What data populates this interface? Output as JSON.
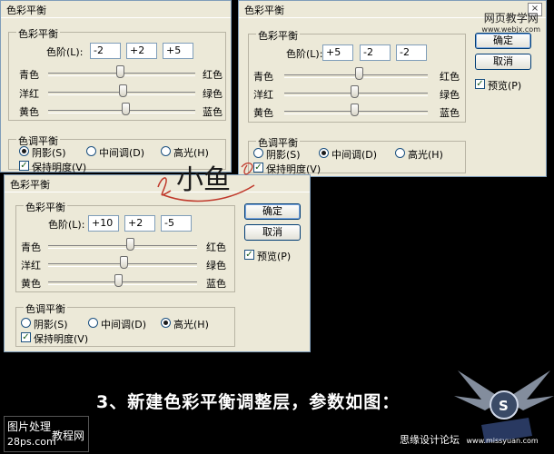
{
  "watermark_top": {
    "line1": "网页教学网",
    "line2": "www.webjx.com"
  },
  "dialog1": {
    "title": "色彩平衡",
    "balance_group": "色彩平衡",
    "levels_label": "色阶(L):",
    "levels": [
      "-2",
      "+2",
      "+5"
    ],
    "sliders": [
      {
        "left": "青色",
        "right": "红色",
        "value": -2
      },
      {
        "left": "洋红",
        "right": "绿色",
        "value": 2
      },
      {
        "left": "黄色",
        "right": "蓝色",
        "value": 5
      }
    ],
    "tone_group": "色调平衡",
    "tones": [
      "阴影(S)",
      "中间调(D)",
      "高光(H)"
    ],
    "selected_tone": 0,
    "preserve_label": "保持明度(V)",
    "preserve_checked": true
  },
  "dialog2": {
    "title": "色彩平衡",
    "balance_group": "色彩平衡",
    "levels_label": "色阶(L):",
    "levels": [
      "+5",
      "-2",
      "-2"
    ],
    "sliders": [
      {
        "left": "青色",
        "right": "红色",
        "value": 5
      },
      {
        "left": "洋红",
        "right": "绿色",
        "value": -2
      },
      {
        "left": "黄色",
        "right": "蓝色",
        "value": -2
      }
    ],
    "tone_group": "色调平衡",
    "tones": [
      "阴影(S)",
      "中间调(D)",
      "高光(H)"
    ],
    "selected_tone": 1,
    "preserve_label": "保持明度(V)",
    "preserve_checked": true,
    "ok": "确定",
    "cancel": "取消",
    "preview_label": "预览(P)",
    "preview_checked": true
  },
  "dialog3": {
    "title": "色彩平衡",
    "balance_group": "色彩平衡",
    "levels_label": "色阶(L):",
    "levels": [
      "+10",
      "+2",
      "-5"
    ],
    "sliders": [
      {
        "left": "青色",
        "right": "红色",
        "value": 10
      },
      {
        "left": "洋红",
        "right": "绿色",
        "value": 2
      },
      {
        "left": "黄色",
        "right": "蓝色",
        "value": -5
      }
    ],
    "tone_group": "色调平衡",
    "tones": [
      "阴影(S)",
      "中间调(D)",
      "高光(H)"
    ],
    "selected_tone": 2,
    "preserve_label": "保持明度(V)",
    "preserve_checked": true,
    "ok": "确定",
    "cancel": "取消",
    "preview_label": "预览(P)",
    "preview_checked": true
  },
  "signature": "小鱼",
  "caption": "3、新建色彩平衡调整层，参数如图：",
  "watermark_bl": {
    "line1": "图片处理",
    "line2": "28ps.com",
    "line3": "教程网"
  },
  "watermark_br": {
    "line1": "思缘设计论坛",
    "line2": "www.missyuan.com"
  }
}
